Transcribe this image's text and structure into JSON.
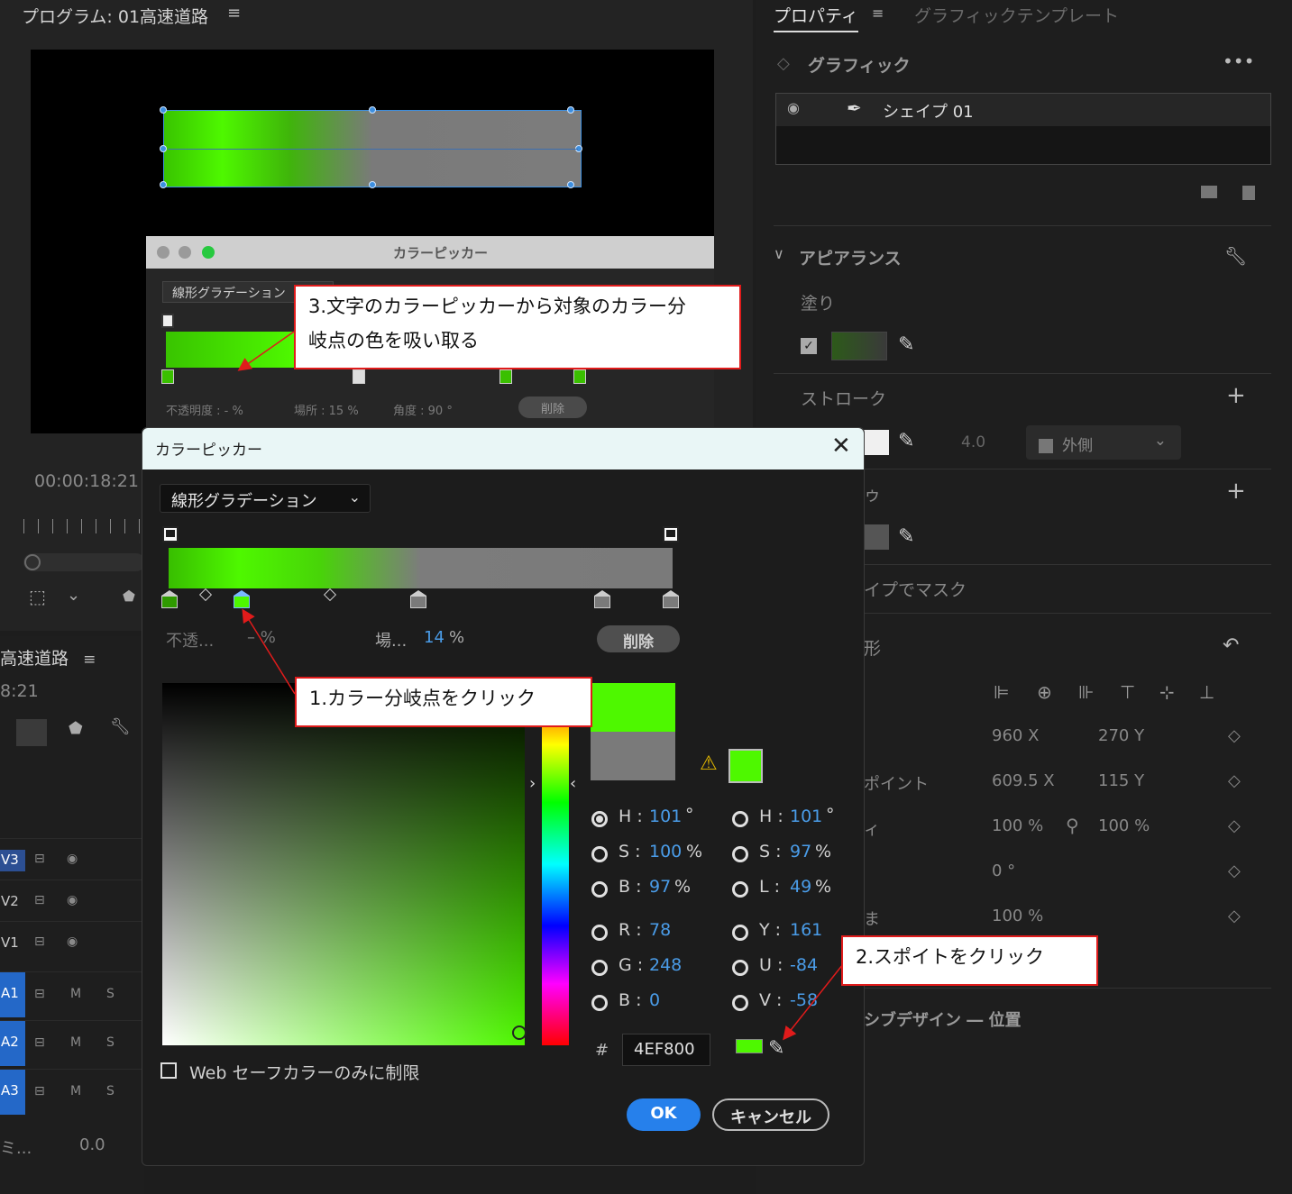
{
  "program": {
    "title": "プログラム: 01高速道路",
    "menu_icon": "≡",
    "timecode": "00:00:18:21"
  },
  "old_picker": {
    "title": "カラーピッカー",
    "mode": "線形グラデーション",
    "opacity": "不透明度 : - %",
    "location": "場所 : 15 %",
    "angle": "角度 : 90 °",
    "delete": "削除"
  },
  "timeline": {
    "title": "高速道路",
    "menu_icon": "≡",
    "time": "8:21",
    "tracks": [
      {
        "label": "V3"
      },
      {
        "label": "V2"
      },
      {
        "label": "V1"
      },
      {
        "label": "A1",
        "m": "M",
        "s": "S"
      },
      {
        "label": "A2",
        "m": "M",
        "s": "S"
      },
      {
        "label": "A3",
        "m": "M",
        "s": "S"
      }
    ],
    "mix_label": "ミ...",
    "mix_value": "0.0"
  },
  "properties": {
    "tab_active": "プロパティ",
    "tab_menu": "≡",
    "tab_other": "グラフィックテンプレート",
    "graphic_label": "グラフィック",
    "more": "•••",
    "layer_name": "シェイプ 01",
    "appearance": "アピアランス",
    "fill": "塗り",
    "stroke": "ストローク",
    "stroke_width": "4.0",
    "stroke_position": "外側",
    "shadow_label_tail": "ゥ",
    "mask": "イプでマスク",
    "transform": "形",
    "position_x": "960 X",
    "position_y": "270 Y",
    "anchor_label": "ポイント",
    "anchor_x": "609.5 X",
    "anchor_y": "115 Y",
    "scale_label": "ィ",
    "scale_w": "100 %",
    "scale_h": "100 %",
    "rotation": "0 °",
    "opacity_label": "ま",
    "opacity": "100 %",
    "responsive": "シブデザイン ― 位置"
  },
  "color_picker": {
    "title": "カラーピッカー",
    "close": "✕",
    "mode": "線形グラデーション",
    "opacity_label": "不透...",
    "opacity_value": "– %",
    "location_label": "場...",
    "location_value": "14",
    "location_unit": "%",
    "delete": "削除",
    "hsb": {
      "h_label": "H :",
      "h_value": "101",
      "h_unit": "°",
      "s_label": "S :",
      "s_value": "100",
      "s_unit": "%",
      "b_label": "B :",
      "b_value": "97",
      "b_unit": "%"
    },
    "hsl": {
      "h_label": "H :",
      "h_value": "101",
      "h_unit": "°",
      "s_label": "S :",
      "s_value": "97",
      "s_unit": "%",
      "l_label": "L :",
      "l_value": "49",
      "l_unit": "%"
    },
    "rgb": {
      "r_label": "R :",
      "r_value": "78",
      "g_label": "G :",
      "g_value": "248",
      "b_label": "B :",
      "b_value": "0"
    },
    "yuv": {
      "y_label": "Y :",
      "y_value": "161",
      "u_label": "U :",
      "u_value": "-84",
      "v_label": "V :",
      "v_value": "-58"
    },
    "hash": "#",
    "hex": "4EF800",
    "websafe_label": "Web セーフカラーのみに制限",
    "ok": "OK",
    "cancel": "キャンセル",
    "current_color": "#4EF800",
    "original_color": "#7A7A7A"
  },
  "annotations": {
    "step1": "1.カラー分岐点をクリック",
    "step2": "2.スポイトをクリック",
    "step3_line1": "3.文字のカラーピッカーから対象のカラー分",
    "step3_line2": "岐点の色を吸い取る"
  }
}
